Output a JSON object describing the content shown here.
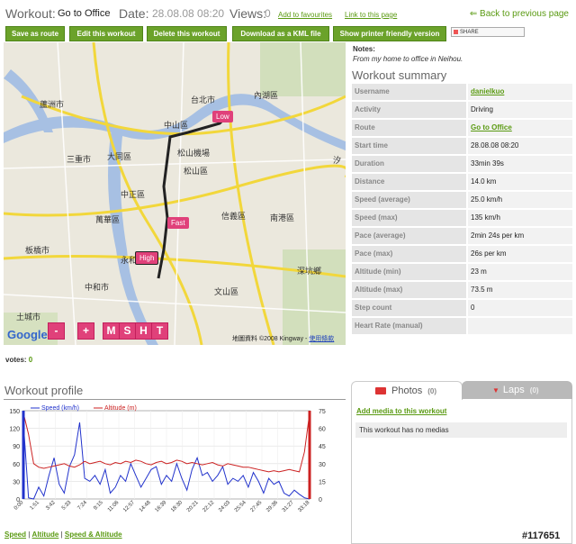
{
  "header": {
    "workout_label": "Workout:",
    "workout_name": "Go to Office",
    "date_label": "Date:",
    "date_value": "28.08.08 08:20",
    "views_label": "Views:",
    "views_value": "0",
    "add_favourites": "Add to favourites",
    "link_page": "Link to this page",
    "back": "⇐ Back to previous page"
  },
  "buttons": {
    "save_route": "Save as route",
    "edit": "Edit this workout",
    "delete": "Delete this workout",
    "download_kml": "Download as a KML file",
    "printer": "Show printer friendly version",
    "share": "SHARE"
  },
  "map": {
    "labels": [
      "蘆洲市",
      "台北市",
      "內湖區",
      "中山區",
      "大同區",
      "三重市",
      "松山機場",
      "松山區",
      "中正區",
      "萬華區",
      "信義區",
      "南港區",
      "板橋市",
      "永和市",
      "中和市",
      "文山區",
      "深坑鄉",
      "土城市",
      "汐"
    ],
    "markers": {
      "low": "Low",
      "fast": "Fast",
      "high": "High"
    },
    "zoom": [
      "-",
      "+",
      "M",
      "S",
      "H",
      "T"
    ],
    "google": "Google",
    "copyright": "地圖資料 ©2008 Kingway -",
    "terms": "使用條款"
  },
  "notes": {
    "label": "Notes:",
    "text": "From my home to office in Neihou."
  },
  "summary": {
    "title": "Workout summary",
    "rows": [
      {
        "k": "Username",
        "v": "danielkuo"
      },
      {
        "k": "Activity",
        "v": "Driving"
      },
      {
        "k": "Route",
        "v": "Go to Office"
      },
      {
        "k": "Start time",
        "v": "28.08.08 08:20"
      },
      {
        "k": "Duration",
        "v": "33min 39s"
      },
      {
        "k": "Distance",
        "v": "14.0 km"
      },
      {
        "k": "Speed (average)",
        "v": "25.0 km/h"
      },
      {
        "k": "Speed (max)",
        "v": "135 km/h"
      },
      {
        "k": "Pace (average)",
        "v": "2min 24s per km"
      },
      {
        "k": "Pace (max)",
        "v": "26s per km"
      },
      {
        "k": "Altitude (min)",
        "v": "23 m"
      },
      {
        "k": "Altitude (max)",
        "v": "73.5 m"
      },
      {
        "k": "Step count",
        "v": "0"
      },
      {
        "k": "Heart Rate (manual)",
        "v": ""
      }
    ]
  },
  "votes": {
    "label": "votes:",
    "value": "0"
  },
  "profile": {
    "title": "Workout profile",
    "links": [
      "Speed",
      "Altitude",
      "Speed & Altitude"
    ]
  },
  "chart_data": {
    "type": "line",
    "x": [
      "0:00",
      "1:51",
      "3:42",
      "5:33",
      "7:24",
      "9:15",
      "11:06",
      "12:57",
      "14:48",
      "16:39",
      "18:30",
      "20:21",
      "22:12",
      "24:03",
      "25:54",
      "27:45",
      "29:36",
      "31:27",
      "33:18"
    ],
    "series": [
      {
        "name": "Speed (km/h)",
        "color": "#2233cc",
        "values": [
          130,
          2,
          0,
          20,
          5,
          40,
          70,
          25,
          10,
          55,
          75,
          130,
          35,
          30,
          40,
          25,
          50,
          10,
          20,
          40,
          30,
          60,
          40,
          20,
          35,
          50,
          55,
          25,
          40,
          30,
          60,
          35,
          15,
          50,
          70,
          40,
          45,
          30,
          40,
          55,
          25,
          35,
          30,
          40,
          20,
          45,
          30,
          10,
          35,
          25,
          30,
          10,
          5,
          15,
          8,
          2,
          0
        ]
      },
      {
        "name": "Altitude (m)",
        "color": "#cc2222",
        "values": [
          73,
          55,
          30,
          27,
          26,
          27,
          28,
          29,
          30,
          28,
          27,
          29,
          32,
          30,
          31,
          32,
          30,
          29,
          31,
          30,
          32,
          31,
          33,
          32,
          30,
          29,
          31,
          32,
          30,
          31,
          33,
          32,
          30,
          31,
          30,
          29,
          30,
          31,
          29,
          28,
          30,
          29,
          28,
          27,
          27,
          26,
          25,
          24,
          23,
          24,
          23,
          24,
          25,
          24,
          23,
          40,
          73
        ]
      }
    ],
    "yleft_ticks": [
      0,
      30,
      60,
      90,
      120,
      150
    ],
    "yright_ticks": [
      0,
      15,
      30,
      45,
      60,
      75
    ],
    "ylim_left": [
      0,
      150
    ],
    "ylim_right": [
      0,
      75
    ],
    "grid": true,
    "legend_placement": "top"
  },
  "media": {
    "photos_tab": "Photos",
    "photos_count": "(0)",
    "laps_tab": "Laps",
    "laps_count": "(0)",
    "add_media": "Add media to this workout",
    "no_media": "This workout has no medias"
  },
  "watermark": "#117651",
  "colors": {
    "accent": "#6ba22a",
    "link": "#5a9a12",
    "marker": "#e0417a"
  }
}
